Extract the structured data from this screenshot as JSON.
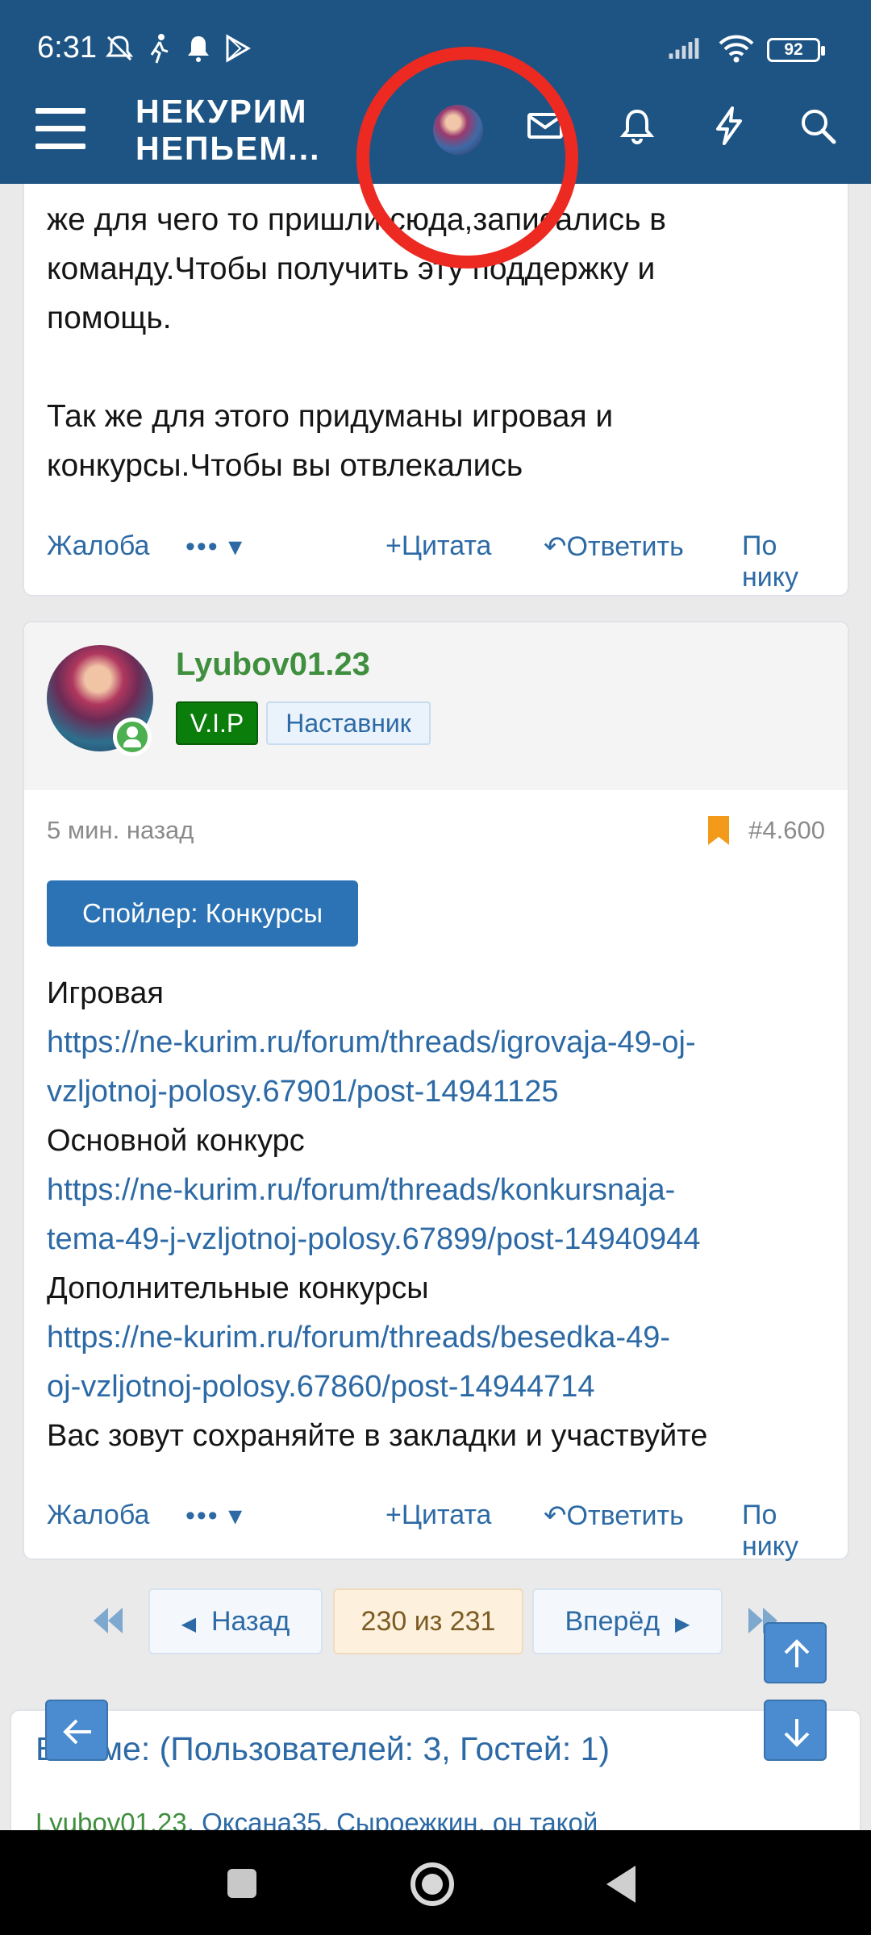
{
  "status_bar": {
    "time": "6:31",
    "battery": "92"
  },
  "header": {
    "logo_line1": "НЕКУРИМ",
    "logo_line2": "НЕПЬЕМ...",
    "icons": [
      "menu-icon",
      "avatar",
      "mail-icon",
      "bell-icon",
      "lightning-icon",
      "search-icon"
    ]
  },
  "post1": {
    "text_lines": [
      "же для чего то пришли сюда,записались в",
      "команду.Чтобы получить эту поддержку и",
      "помощь.",
      "",
      "Так же для этого придуманы игровая и",
      "конкурсы.Чтобы вы отвлекались"
    ],
    "actions": {
      "report": "Жалоба",
      "more": "•••",
      "quote": "Цитата",
      "reply": "Ответить",
      "by_nick": "По нику"
    }
  },
  "post2": {
    "author": "Lyubov01.23",
    "badge_vip": "V.I.P",
    "badge_role": "Наставник",
    "time_ago": "5 мин. назад",
    "post_number": "#4.600",
    "spoiler_label": "Спойлер: Конкурсы",
    "content": {
      "label1": "Игровая",
      "link1_a": "https://ne-kurim.ru/forum/threads/igrovaja-49-oj-",
      "link1_b": "vzljotnoj-polosy.67901/post-14941125",
      "label2": "Основной конкурс",
      "link2_a": "https://ne-kurim.ru/forum/threads/konkursnaja-",
      "link2_b": "tema-49-j-vzljotnoj-polosy.67899/post-14940944",
      "label3": "Дополнительные конкурсы",
      "link3_a": "https://ne-kurim.ru/forum/threads/besedka-49-",
      "link3_b": "oj-vzljotnoj-polosy.67860/post-14944714",
      "closing": "Вас зовут сохраняйте в закладки и участвуйте"
    },
    "actions": {
      "report": "Жалоба",
      "more": "•••",
      "quote": "Цитата",
      "reply": "Ответить",
      "by_nick": "По нику"
    }
  },
  "pagination": {
    "prev": "Назад",
    "current": "230 из 231",
    "next": "Вперёд"
  },
  "in_thread": {
    "title": "В теме: (Пользователей: 3, Гостей: 1)",
    "user1": "Lyubov01.23",
    "user2": "Оксана35",
    "user3": "Сыроежкин, он такой"
  },
  "colors": {
    "header_bg": "#1d5483",
    "link": "#2d6aa5",
    "accent_red": "#ec2a22",
    "vip_green": "#0b7d0b"
  }
}
